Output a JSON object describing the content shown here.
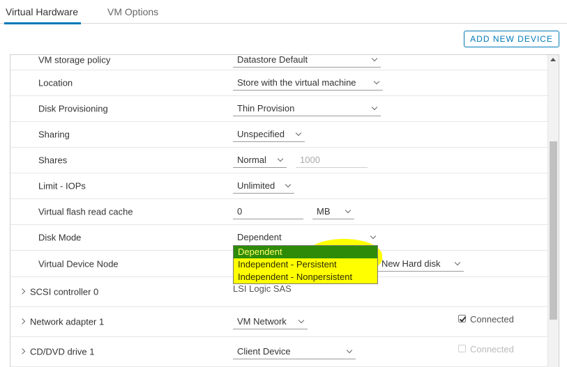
{
  "tabs": {
    "virtual_hardware": "Virtual Hardware",
    "vm_options": "VM Options"
  },
  "toolbar": {
    "add_new_device": "ADD NEW DEVICE"
  },
  "rows": {
    "storage_policy": {
      "label": "VM storage policy",
      "value": "Datastore Default"
    },
    "location": {
      "label": "Location",
      "value": "Store with the virtual machine"
    },
    "provisioning": {
      "label": "Disk Provisioning",
      "value": "Thin Provision"
    },
    "sharing": {
      "label": "Sharing",
      "value": "Unspecified"
    },
    "shares": {
      "label": "Shares",
      "value": "Normal",
      "amount_placeholder": "1000"
    },
    "limit_iops": {
      "label": "Limit - IOPs",
      "value": "Unlimited"
    },
    "flash_cache": {
      "label": "Virtual flash read cache",
      "value": "0",
      "unit": "MB"
    },
    "disk_mode": {
      "label": "Disk Mode",
      "value": "Dependent",
      "options": [
        "Dependent",
        "Independent - Persistent",
        "Independent - Nonpersistent"
      ]
    },
    "device_node": {
      "label": "Virtual Device Node",
      "value": ") New Hard disk"
    },
    "scsi": {
      "label": "SCSI controller 0",
      "value": "LSI Logic SAS"
    },
    "network": {
      "label": "Network adapter 1",
      "value": "VM Network",
      "connected": "Connected"
    },
    "cddvd": {
      "label": "CD/DVD drive 1",
      "value": "Client Device",
      "connected": "Connected"
    }
  },
  "colors": {
    "accent": "#0079b8",
    "highlight": "#ffff00",
    "selected_option": "#2e8b0a"
  }
}
